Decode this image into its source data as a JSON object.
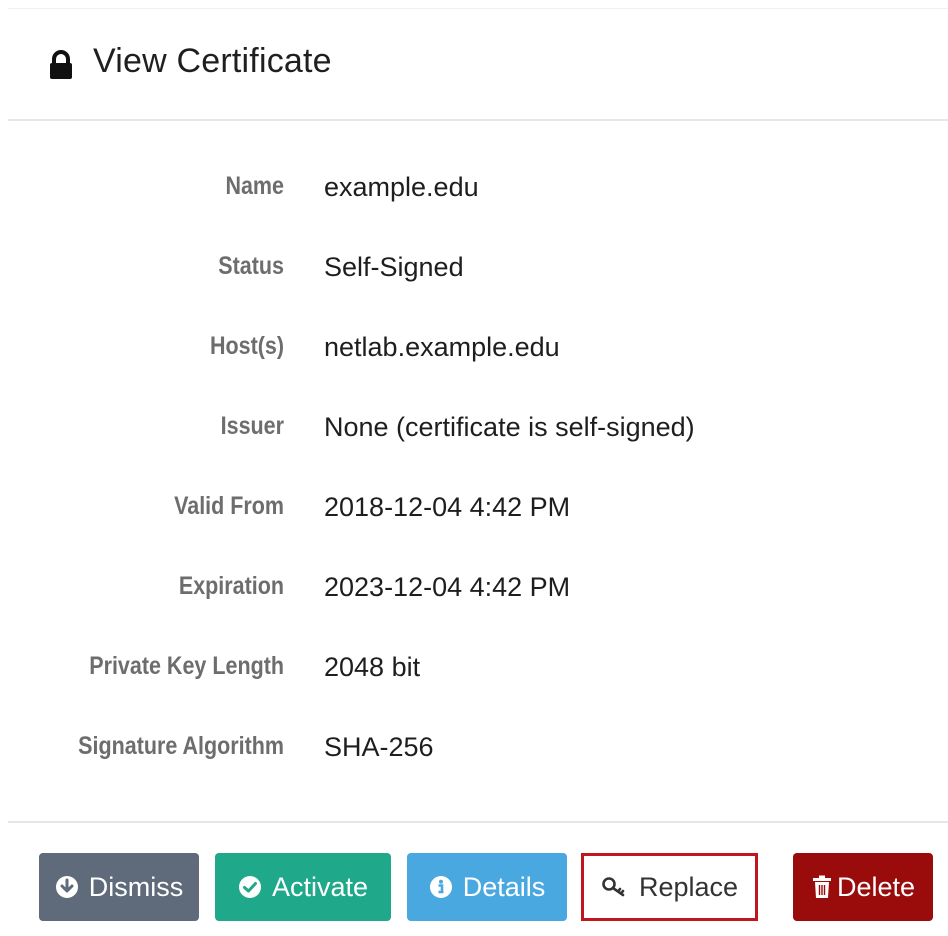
{
  "header": {
    "title": "View Certificate",
    "icon": "lock-icon"
  },
  "fields": [
    {
      "label": "Name",
      "value": "example.edu"
    },
    {
      "label": "Status",
      "value": "Self-Signed"
    },
    {
      "label": "Host(s)",
      "value": "netlab.example.edu"
    },
    {
      "label": "Issuer",
      "value": "None (certificate is self-signed)"
    },
    {
      "label": "Valid From",
      "value": "2018-12-04 4:42 PM"
    },
    {
      "label": "Expiration",
      "value": "2023-12-04 4:42 PM"
    },
    {
      "label": "Private Key Length",
      "value": "2048 bit"
    },
    {
      "label": "Signature Algorithm",
      "value": "SHA-256"
    }
  ],
  "actions": {
    "dismiss": {
      "label": "Dismiss",
      "icon": "arrow-down-circle-icon",
      "color": "#5f6b7a"
    },
    "activate": {
      "label": "Activate",
      "icon": "check-circle-icon",
      "color": "#20a88a"
    },
    "details": {
      "label": "Details",
      "icon": "info-circle-icon",
      "color": "#4aa8e0"
    },
    "replace": {
      "label": "Replace",
      "icon": "key-icon",
      "color": "#ffffff",
      "outline": "#c0161f"
    },
    "delete": {
      "label": "Delete",
      "icon": "trash-icon",
      "color": "#9a0b0b"
    }
  }
}
